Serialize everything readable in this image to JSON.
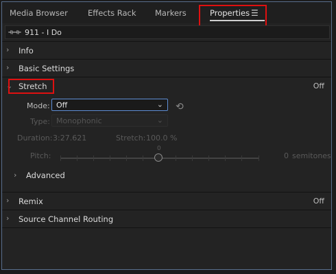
{
  "tabs": [
    {
      "label": "Media Browser",
      "active": false
    },
    {
      "label": "Effects Rack",
      "active": false
    },
    {
      "label": "Markers",
      "active": false
    },
    {
      "label": "Properties",
      "active": true
    }
  ],
  "icons": {
    "menu": "hamburger-menu-icon",
    "waveform": "waveform-icon",
    "chevron_collapsed": "chevron-right-icon",
    "chevron_expanded": "chevron-down-icon",
    "reset": "reset-icon",
    "dropdown": "dropdown-arrow-icon"
  },
  "clip": {
    "name": "911 - I Do"
  },
  "sections": {
    "info": {
      "title": "Info"
    },
    "basic_settings": {
      "title": "Basic Settings"
    },
    "stretch": {
      "title": "Stretch",
      "state": "Off",
      "mode_label": "Mode:",
      "mode_value": "Off",
      "type_label": "Type:",
      "type_value": "Monophonic",
      "duration_label": "Duration:",
      "duration_value": "3:27.621",
      "stretch_label": "Stretch:",
      "stretch_value": "100.0 %",
      "pitch_label": "Pitch:",
      "pitch_zero": "0",
      "pitch_value": "0",
      "pitch_unit": "semitones",
      "advanced": "Advanced"
    },
    "remix": {
      "title": "Remix",
      "state": "Off"
    },
    "source_channel_routing": {
      "title": "Source Channel Routing"
    }
  },
  "colors": {
    "highlight_box": "#e01010",
    "focus_border": "#5f8fd6",
    "panel_bg": "#232323"
  }
}
